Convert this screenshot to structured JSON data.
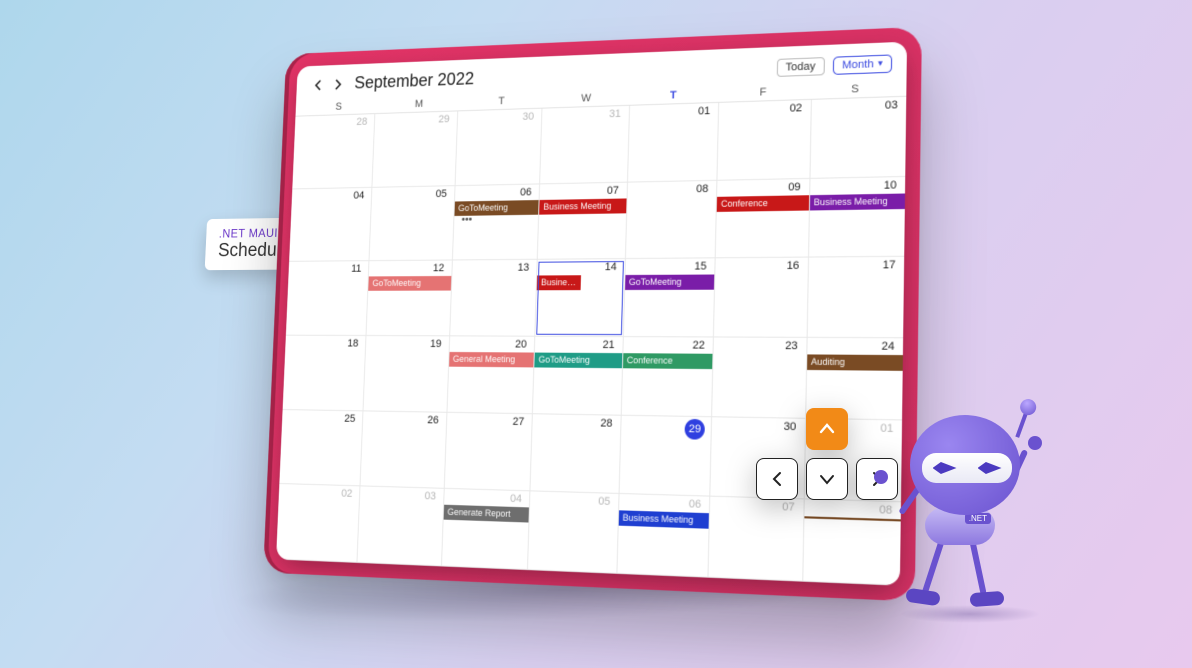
{
  "badge": {
    "line1": ".NET MAUI",
    "line2": "Scheduler"
  },
  "header": {
    "title": "September 2022",
    "today_label": "Today",
    "view_label": "Month"
  },
  "weekdays": [
    "S",
    "M",
    "T",
    "W",
    "T",
    "F",
    "S"
  ],
  "today_col_index": 4,
  "colors": {
    "red": "#c81818",
    "salmon": "#e57373",
    "purple": "#7a1da8",
    "blue": "#1f3fd1",
    "brown": "#7a4b24",
    "teal": "#1f9c86",
    "green": "#2f9a64",
    "grey": "#6e6e6e"
  },
  "weeks": [
    [
      {
        "n": "28",
        "dim": true
      },
      {
        "n": "29",
        "dim": true
      },
      {
        "n": "30",
        "dim": true
      },
      {
        "n": "31",
        "dim": true
      },
      {
        "n": "01"
      },
      {
        "n": "02"
      },
      {
        "n": "03"
      }
    ],
    [
      {
        "n": "04"
      },
      {
        "n": "05"
      },
      {
        "n": "06",
        "events": [
          {
            "t": "GoToMeeting",
            "c": "brown"
          }
        ],
        "more": true
      },
      {
        "n": "07",
        "events": [
          {
            "t": "Business Meeting",
            "c": "red"
          }
        ]
      },
      {
        "n": "08"
      },
      {
        "n": "09",
        "events": [
          {
            "t": "Conference",
            "c": "red"
          }
        ]
      },
      {
        "n": "10",
        "events": [
          {
            "t": "Business Meeting",
            "c": "purple"
          }
        ]
      }
    ],
    [
      {
        "n": "11"
      },
      {
        "n": "12",
        "events": [
          {
            "t": "GoToMeeting",
            "c": "salmon"
          }
        ]
      },
      {
        "n": "13"
      },
      {
        "n": "14",
        "selected": true,
        "events": [
          {
            "t": "Business Meeting",
            "c": "red",
            "half": true
          }
        ]
      },
      {
        "n": "15",
        "events": [
          {
            "t": "GoToMeeting",
            "c": "purple"
          }
        ]
      },
      {
        "n": "16"
      },
      {
        "n": "17"
      }
    ],
    [
      {
        "n": "18"
      },
      {
        "n": "19"
      },
      {
        "n": "20",
        "events": [
          {
            "t": "General Meeting",
            "c": "salmon"
          }
        ]
      },
      {
        "n": "21",
        "events": [
          {
            "t": "GoToMeeting",
            "c": "teal"
          }
        ]
      },
      {
        "n": "22",
        "events": [
          {
            "t": "Conference",
            "c": "green"
          }
        ]
      },
      {
        "n": "23"
      },
      {
        "n": "24",
        "events": [
          {
            "t": "Auditing",
            "c": "brown"
          }
        ]
      }
    ],
    [
      {
        "n": "25"
      },
      {
        "n": "26"
      },
      {
        "n": "27"
      },
      {
        "n": "28"
      },
      {
        "n": "29",
        "today": true
      },
      {
        "n": "30"
      },
      {
        "n": "01",
        "dim": true
      }
    ],
    [
      {
        "n": "02",
        "dim": true
      },
      {
        "n": "03",
        "dim": true
      },
      {
        "n": "04",
        "dim": true,
        "events": [
          {
            "t": "Generate Report",
            "c": "grey"
          }
        ]
      },
      {
        "n": "05",
        "dim": true
      },
      {
        "n": "06",
        "dim": true,
        "events": [
          {
            "t": "Business Meeting",
            "c": "blue"
          }
        ]
      },
      {
        "n": "07",
        "dim": true
      },
      {
        "n": "08",
        "dim": true,
        "events": [
          {
            "t": " ",
            "c": "brown"
          }
        ]
      }
    ]
  ],
  "robot_tag": ".NET"
}
